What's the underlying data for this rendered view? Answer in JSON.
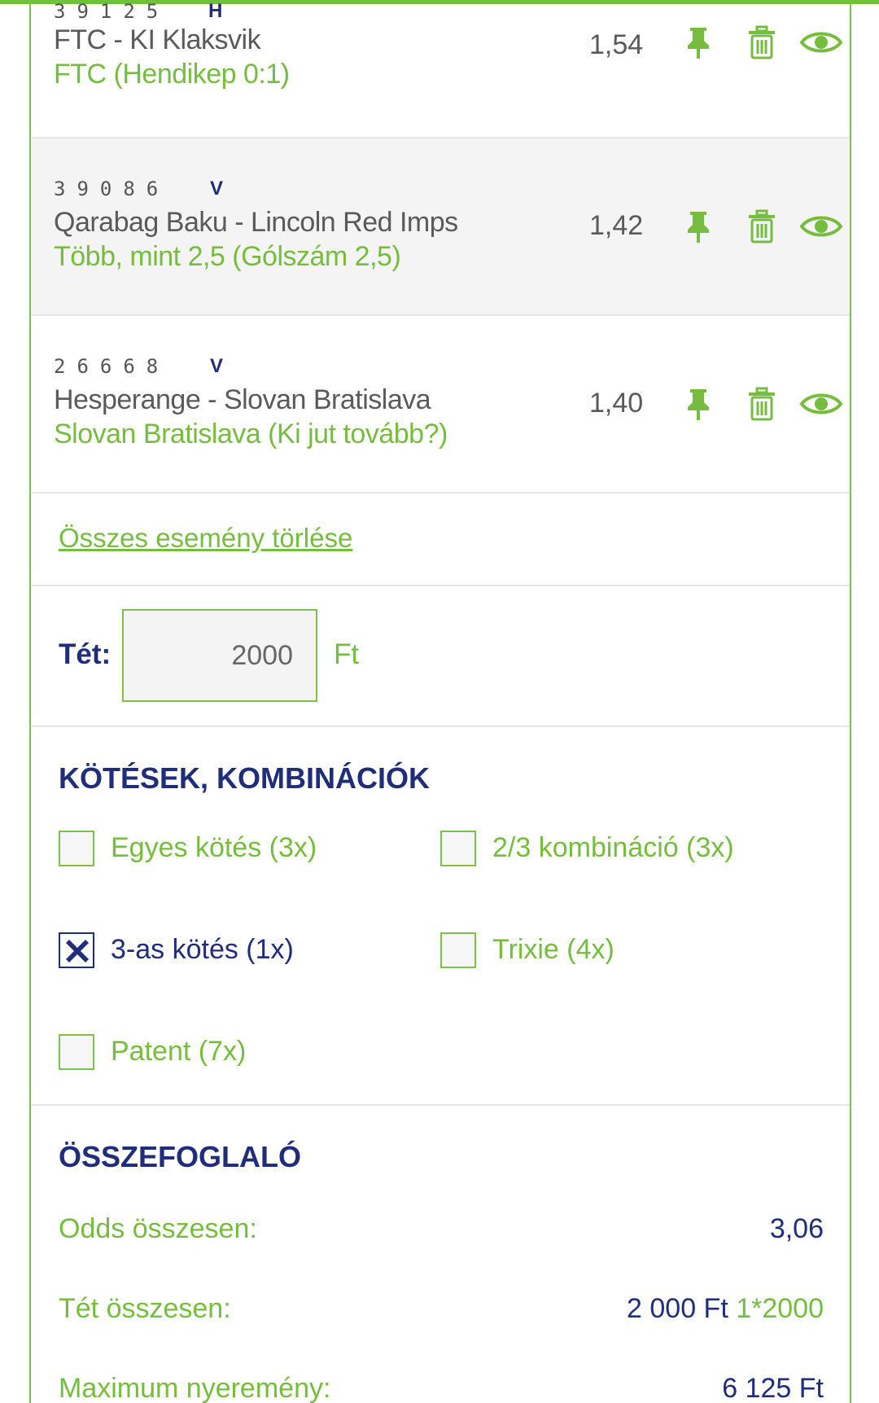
{
  "events": [
    {
      "code": "39125",
      "flag": "H",
      "match": "FTC - KI Klaksvik",
      "pick": "FTC (Hendikep 0:1)",
      "odds": "1,54"
    },
    {
      "code": "39086",
      "flag": "V",
      "match": "Qarabag Baku - Lincoln Red Imps",
      "pick": "Több, mint 2,5 (Gólszám 2,5)",
      "odds": "1,42"
    },
    {
      "code": "26668",
      "flag": "V",
      "match": "Hesperange - Slovan Bratislava",
      "pick": "Slovan Bratislava (Ki jut tovább?)",
      "odds": "1,40"
    }
  ],
  "clear_all": "Összes esemény törlése",
  "stake": {
    "label": "Tét:",
    "value": "2000",
    "unit": "Ft"
  },
  "combinations": {
    "title": "KÖTÉSEK, KOMBINÁCIÓK",
    "options": [
      {
        "label": "Egyes kötés (3x)",
        "checked": false
      },
      {
        "label": "2/3 kombináció (3x)",
        "checked": false
      },
      {
        "label": "3-as kötés (1x)",
        "checked": true
      },
      {
        "label": "Trixie (4x)",
        "checked": false
      },
      {
        "label": "Patent (7x)",
        "checked": false
      }
    ]
  },
  "summary": {
    "title": "ÖSSZEFOGLALÓ",
    "odds_label": "Odds összesen:",
    "odds_value": "3,06",
    "stake_label": "Tét összesen:",
    "stake_value": "2 000 Ft",
    "stake_extra": "1*2000",
    "max_win_label": "Maximum nyeremény:",
    "max_win_value": "6 125 Ft"
  },
  "colors": {
    "green": "#76bd3f",
    "navy": "#1f2d7a",
    "text_gray": "#5a5a5a"
  },
  "icons": [
    "pin-icon",
    "trash-icon",
    "eye-icon",
    "check-x-icon"
  ]
}
